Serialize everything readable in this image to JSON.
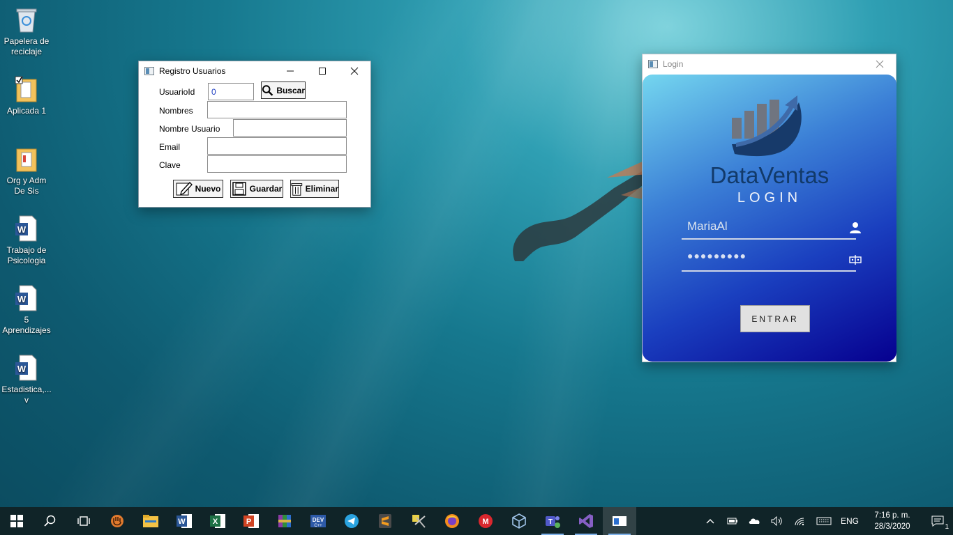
{
  "desktop": {
    "icons": [
      {
        "label": "Papelera de reciclaje",
        "icon": "recycle-bin-icon"
      },
      {
        "label": "Aplicada 1",
        "icon": "folder-icon"
      },
      {
        "label": "Org y Adm De Sis",
        "icon": "folder-icon"
      },
      {
        "label": "Trabajo de Psicologia",
        "icon": "word-doc-icon"
      },
      {
        "label": "5 Aprendizajes",
        "icon": "word-doc-icon"
      },
      {
        "label": "Estadistica,... v",
        "icon": "word-doc-icon"
      }
    ]
  },
  "registro": {
    "title": "Registro Usuarios",
    "labels": {
      "usuario_id": "UsuarioId",
      "nombres": "Nombres",
      "nombre_usuario": "Nombre Usuario",
      "email": "Email",
      "clave": "Clave"
    },
    "values": {
      "usuario_id": "0",
      "nombres": "",
      "nombre_usuario": "",
      "email": "",
      "clave": ""
    },
    "buttons": {
      "buscar": "Buscar",
      "nuevo": "Nuevo",
      "guardar": "Guardar",
      "eliminar": "Eliminar"
    }
  },
  "login": {
    "title": "Login",
    "brand": "DataVentas",
    "subtitle": "LOGIN",
    "username": "MariaAl",
    "password_masked": "●●●●●●●●●",
    "enter_button": "ENTRAR"
  },
  "taskbar": {
    "apps": [
      "start-icon",
      "search-icon",
      "task-view-icon",
      "hand-app-icon",
      "file-explorer-icon",
      "word-icon",
      "excel-icon",
      "powerpoint-icon",
      "winrar-icon",
      "dev-cpp-icon",
      "telegram-icon",
      "sublime-text-icon",
      "tools-app-icon",
      "firefox-icon",
      "mega-icon",
      "virtualbox-icon",
      "teams-icon",
      "visual-studio-icon",
      "running-app-icon"
    ],
    "tray": {
      "language": "ENG",
      "time": "7:16 p. m.",
      "date": "28/3/2020",
      "notifications": "1"
    }
  },
  "colors": {
    "login_gradient_start": "#74d6ef",
    "login_gradient_end": "#06008f",
    "brand_text": "#123a6a",
    "logo_gray": "#707580",
    "taskbar": "#102428"
  }
}
